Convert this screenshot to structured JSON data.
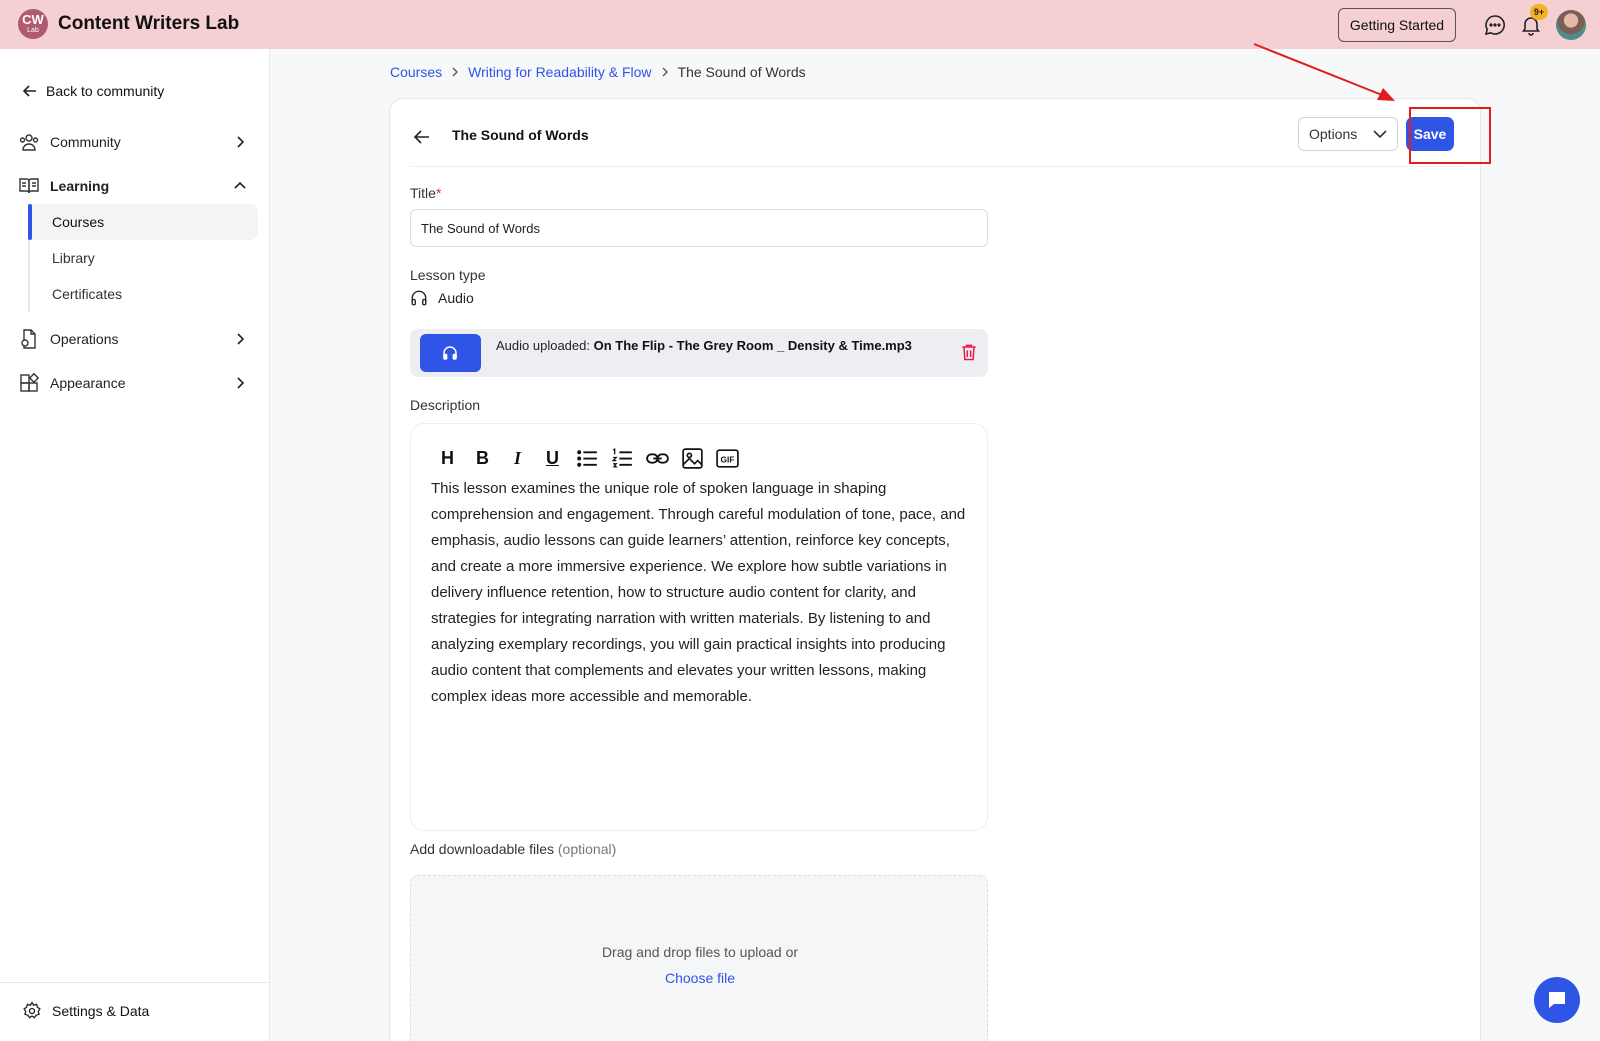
{
  "app": {
    "logo_text": "CW",
    "logo_sub": "Lab",
    "name": "Content Writers Lab",
    "getting_started_label": "Getting Started",
    "notifications_badge": "9+"
  },
  "sidebar": {
    "back_label": "Back to community",
    "items": [
      {
        "label": "Community",
        "icon": "community-icon",
        "chevron": "right"
      },
      {
        "label": "Learning",
        "icon": "book-icon",
        "chevron": "up"
      },
      {
        "label": "Operations",
        "icon": "operations-icon",
        "chevron": "right"
      },
      {
        "label": "Appearance",
        "icon": "appearance-icon",
        "chevron": "right"
      }
    ],
    "learning_sub": [
      {
        "label": "Courses",
        "active": true
      },
      {
        "label": "Library",
        "active": false
      },
      {
        "label": "Certificates",
        "active": false
      }
    ],
    "settings_label": "Settings & Data"
  },
  "breadcrumb": {
    "items": [
      "Courses",
      "Writing for Readability & Flow"
    ],
    "current": "The Sound of Words"
  },
  "lesson": {
    "header_title": "The Sound of Words",
    "options_label": "Options",
    "save_label": "Save",
    "title_label": "Title",
    "title_required": "*",
    "title_value": "The Sound of Words",
    "lesson_type_label": "Lesson type",
    "lesson_type_value": "Audio",
    "audio_prefix": "Audio uploaded: ",
    "audio_file": "On The Flip - The Grey Room _ Density & Time.mp3",
    "description_label": "Description",
    "description_text": "This lesson examines the unique role of spoken language in shaping comprehension and engagement. Through careful modulation of tone, pace, and emphasis, audio lessons can guide learners’ attention, reinforce key concepts, and create a more immersive experience. We explore how subtle variations in delivery influence retention, how to structure audio content for clarity, and strategies for integrating narration with written materials. By listening to and analyzing exemplary recordings, you will gain practical insights into producing audio content that complements and elevates your written lessons, making complex ideas more accessible and memorable.",
    "files_label": "Add downloadable files",
    "files_optional": "(optional)",
    "drop_text": "Drag and drop files to upload or",
    "choose_file_label": "Choose file"
  },
  "toolbar": {
    "heading": "H",
    "bold": "B",
    "italic": "I",
    "underline": "U",
    "icons": [
      "heading-icon",
      "bold-icon",
      "italic-icon",
      "underline-icon",
      "bullet-list-icon",
      "numbered-list-icon",
      "link-icon",
      "image-icon",
      "gif-icon"
    ]
  },
  "colors": {
    "accent": "#2e55e6",
    "topbar": "#f5d0d3",
    "annotation": "#e11d1d"
  }
}
